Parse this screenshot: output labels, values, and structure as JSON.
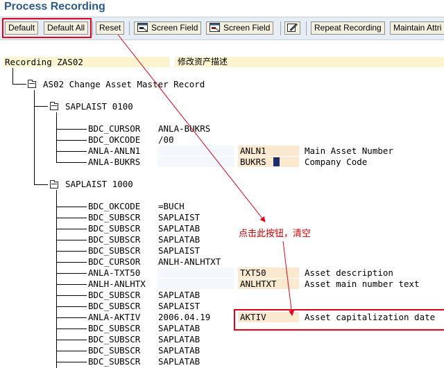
{
  "window": {
    "title": "Process Recording"
  },
  "toolbar": {
    "default_label": "Default",
    "default_all_label": "Default All",
    "reset_label": "Reset",
    "screen_field_1_label": "Screen Field",
    "screen_field_2_label": "Screen Field",
    "repeat_recording_label": "Repeat Recording",
    "maintain_attri_label": "Maintain Attri"
  },
  "recording": {
    "header_label": "Recording ZAS02",
    "header_desc": "修改资产描述",
    "transaction": "AS02 Change Asset Master Record",
    "screens": [
      {
        "name": "SAPLAIST 0100",
        "rows": [
          {
            "field": "BDC_CURSOR",
            "value": "ANLA-BUKRS",
            "screen_field": "",
            "desc": ""
          },
          {
            "field": "BDC_OKCODE",
            "value": "/00",
            "screen_field": "",
            "desc": ""
          },
          {
            "field": "ANLA-ANLN1",
            "value": "",
            "screen_field": "ANLN1",
            "desc": "Main Asset Number"
          },
          {
            "field": "ANLA-BUKRS",
            "value": "",
            "screen_field": "BUKRS",
            "desc": "Company Code"
          }
        ]
      },
      {
        "name": "SAPLAIST 1000",
        "rows": [
          {
            "field": "BDC_OKCODE",
            "value": "=BUCH",
            "screen_field": "",
            "desc": ""
          },
          {
            "field": "BDC_SUBSCR",
            "value": "SAPLAIST",
            "screen_field": "",
            "desc": ""
          },
          {
            "field": "BDC_SUBSCR",
            "value": "SAPLATAB",
            "screen_field": "",
            "desc": ""
          },
          {
            "field": "BDC_SUBSCR",
            "value": "SAPLATAB",
            "screen_field": "",
            "desc": ""
          },
          {
            "field": "BDC_SUBSCR",
            "value": "SAPLAIST",
            "screen_field": "",
            "desc": ""
          },
          {
            "field": "BDC_CURSOR",
            "value": "ANLH-ANLHTXT",
            "screen_field": "",
            "desc": ""
          },
          {
            "field": "ANLA-TXT50",
            "value": "",
            "screen_field": "TXT50",
            "desc": "Asset description"
          },
          {
            "field": "ANLH-ANLHTX",
            "value": "",
            "screen_field": "ANLHTXT",
            "desc": "Asset main number text"
          },
          {
            "field": "BDC_SUBSCR",
            "value": "SAPLATAB",
            "screen_field": "",
            "desc": ""
          },
          {
            "field": "BDC_SUBSCR",
            "value": "SAPLAIST",
            "screen_field": "",
            "desc": ""
          },
          {
            "field": "ANLA-AKTIV",
            "value": "2006.04.19",
            "screen_field": "AKTIV",
            "desc": "Asset capitalization date"
          },
          {
            "field": "BDC_SUBSCR",
            "value": "SAPLATAB",
            "screen_field": "",
            "desc": ""
          },
          {
            "field": "BDC_SUBSCR",
            "value": "SAPLATAB",
            "screen_field": "",
            "desc": ""
          },
          {
            "field": "BDC_SUBSCR",
            "value": "SAPLATAB",
            "screen_field": "",
            "desc": ""
          },
          {
            "field": "BDC_SUBSCR",
            "value": "SAPLATAB",
            "screen_field": "",
            "desc": ""
          }
        ]
      }
    ]
  },
  "annotation": {
    "text": "点击此按钮，清空"
  },
  "colors": {
    "annotation_red": "#e0001b",
    "field_bg": "#fbe9cf",
    "title_blue": "#2a5a8a"
  },
  "icons": [
    "screen-field-icon",
    "screen-field-icon",
    "edit-pencil-icon",
    "folder-icon"
  ]
}
